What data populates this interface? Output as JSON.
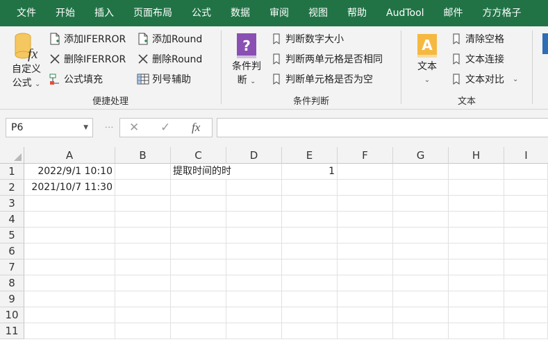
{
  "tabs": [
    "文件",
    "开始",
    "插入",
    "页面布局",
    "公式",
    "数据",
    "审阅",
    "视图",
    "帮助",
    "AudTool",
    "邮件",
    "方方格子"
  ],
  "ribbon": {
    "custom_formula": {
      "line1": "自定义",
      "line2": "公式"
    },
    "group1": {
      "items": [
        {
          "label": "添加IFERROR",
          "icon": "add-doc-icon"
        },
        {
          "label": "删除IFERROR",
          "icon": "x-icon"
        },
        {
          "label": "公式填充",
          "icon": "fill-icon"
        },
        {
          "label": "添加Round",
          "icon": "add-doc-icon"
        },
        {
          "label": "删除Round",
          "icon": "x-icon"
        },
        {
          "label": "列号辅助",
          "icon": "grid-icon"
        }
      ],
      "label": "便捷处理"
    },
    "group2": {
      "big": {
        "line1": "条件判",
        "line2": "断"
      },
      "items": [
        {
          "label": "判断数字大小",
          "icon": "bookmark-icon"
        },
        {
          "label": "判断两单元格是否相同",
          "icon": "bookmark-icon"
        },
        {
          "label": "判断单元格是否为空",
          "icon": "bookmark-icon"
        }
      ],
      "label": "条件判断"
    },
    "group3": {
      "big": {
        "line1": "文本"
      },
      "items": [
        {
          "label": "清除空格",
          "icon": "bookmark-icon"
        },
        {
          "label": "文本连接",
          "icon": "bookmark-icon"
        },
        {
          "label": "文本对比",
          "icon": "bookmark-icon"
        }
      ],
      "label": "文本"
    }
  },
  "formula_bar": {
    "name_box": "P6",
    "fx": "fx",
    "formula": ""
  },
  "columns": [
    "A",
    "B",
    "C",
    "D",
    "E",
    "F",
    "G",
    "H",
    "I"
  ],
  "rows": [
    "1",
    "2",
    "3",
    "4",
    "5",
    "6",
    "7",
    "8",
    "9",
    "10",
    "11"
  ],
  "cells": {
    "A1": "2022/9/1 10:10",
    "A2": "2021/10/7 11:30",
    "C1": "提取时间的时",
    "E1": "1"
  },
  "colors": {
    "accent": "#217346"
  }
}
